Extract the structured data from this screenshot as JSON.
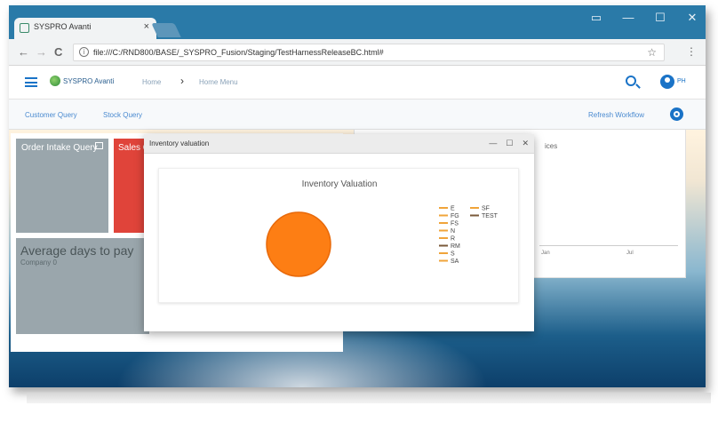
{
  "browser": {
    "tab_title": "SYSPRO Avanti",
    "tab_close": "×",
    "url": "file:///C:/RND800/BASE/_SYSPRO_Fusion/Staging/TestHarnessReleaseBC.html#",
    "win_controls": [
      "▭",
      "—",
      "☐",
      "✕"
    ],
    "nav_back": "←",
    "nav_forward": "→",
    "nav_reload": "C",
    "info_glyph": "i",
    "star": "☆",
    "menu_glyph": "⋮"
  },
  "app": {
    "logo_text": "SYSPRO Avanti",
    "breadcrumb_home": "Home",
    "breadcrumb_sep": "›",
    "breadcrumb_current": "Home Menu",
    "user_name": "PH"
  },
  "subnav": {
    "customer_query": "Customer Query",
    "stock_query": "Stock Query",
    "refresh": "Refresh Workflow"
  },
  "tiles": {
    "order_intake": "Order Intake Query",
    "sales": "Sales Query",
    "avg_days": "Average days to pay",
    "avg_days_sub": "Company 0"
  },
  "back_panel": {
    "title_fragment": "ices",
    "tick_1": "Jan",
    "tick_2": "Jul"
  },
  "inventory_window": {
    "title": "Inventory valuation",
    "minimize": "—",
    "maximize": "☐",
    "close": "✕"
  },
  "colors": {
    "accent": "#1a73c7",
    "sales_tile": "#e0443a",
    "gray_tile": "#9aa6ac",
    "pie": "#fd7e14"
  },
  "chart_data": {
    "type": "pie",
    "title": "Inventory Valuation",
    "series": [
      {
        "name": "E",
        "color": "#f0a43a"
      },
      {
        "name": "FG",
        "color": "#f0a43a"
      },
      {
        "name": "FS",
        "color": "#f0a43a"
      },
      {
        "name": "N",
        "color": "#f0a43a"
      },
      {
        "name": "R",
        "color": "#f0a43a"
      },
      {
        "name": "RM",
        "color": "#7a5a3a"
      },
      {
        "name": "S",
        "color": "#f0a43a"
      },
      {
        "name": "SA",
        "color": "#f0a43a"
      },
      {
        "name": "SF",
        "color": "#f0a43a"
      },
      {
        "name": "TEST",
        "color": "#7a5a3a"
      }
    ],
    "slices": [
      {
        "label": "FG",
        "value": 100
      }
    ],
    "legend_position": "right"
  }
}
